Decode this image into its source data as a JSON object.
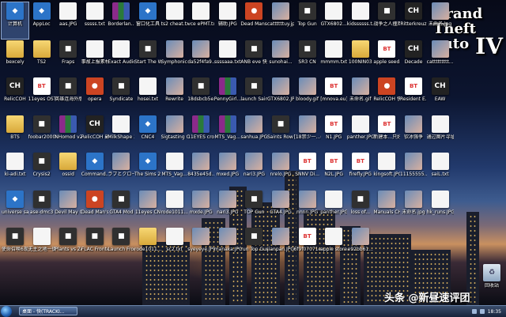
{
  "desktop": {
    "watermark": {
      "line1": "Grand",
      "line2": "Theft",
      "line3": "auto",
      "roman": "IV"
    }
  },
  "icons": [
    {
      "label": "计算机",
      "type": "blue",
      "sel": true
    },
    {
      "label": "AppLoc",
      "type": "blue"
    },
    {
      "label": "aas.JPG",
      "type": "doc"
    },
    {
      "label": "sssss.txt",
      "type": "doc"
    },
    {
      "label": "Borderlan...",
      "type": "rar"
    },
    {
      "label": "窗口化工具",
      "type": "blue"
    },
    {
      "label": "ts2 cheat.txt",
      "type": "doc"
    },
    {
      "label": "vce ePMT.txt",
      "type": "doc"
    },
    {
      "label": "辅助.JPG",
      "type": "doc"
    },
    {
      "label": "Dead Mans Hand",
      "type": "red"
    },
    {
      "label": "cattttttuy.jpg",
      "type": "img"
    },
    {
      "label": "Top Gun",
      "type": "dark"
    },
    {
      "label": "GTX6802...",
      "type": "doc"
    },
    {
      "label": "kidssssss.t...",
      "type": "doc"
    },
    {
      "label": "战争之人撞库中文版",
      "type": "dark"
    },
    {
      "label": "Ritterkreuz",
      "type": "ch"
    },
    {
      "label": "未命名.jpg",
      "type": "img"
    },
    {
      "label": "bexcely",
      "type": "folder"
    },
    {
      "label": "TS2",
      "type": "folder"
    },
    {
      "label": "Fraps",
      "type": "dark"
    },
    {
      "label": "事故上报素材.txt",
      "type": "doc"
    },
    {
      "label": "Exact Audio Copy",
      "type": "doc"
    },
    {
      "label": "Start The Witcher 2",
      "type": "dark"
    },
    {
      "label": "Symphonic Rain",
      "type": "img"
    },
    {
      "label": "da52f4fa9...",
      "type": "img"
    },
    {
      "label": "ssssaaa.txt",
      "type": "doc"
    },
    {
      "label": "ANB eve 快捷方式",
      "type": "dark"
    },
    {
      "label": "sunohai...",
      "type": "img"
    },
    {
      "label": "SR3 CN",
      "type": "dark"
    },
    {
      "label": "mmmm.txt",
      "type": "doc"
    },
    {
      "label": "100NIN03",
      "type": "folder"
    },
    {
      "label": "apple seed.torrent",
      "type": "gif"
    },
    {
      "label": "Decade",
      "type": "ch"
    },
    {
      "label": "cattttttttt...",
      "type": "img"
    },
    {
      "label": "RelicCOH",
      "type": "ch"
    },
    {
      "label": "11eyes OST.torrent",
      "type": "gif"
    },
    {
      "label": "英雄连海外版",
      "type": "dark"
    },
    {
      "label": "opera",
      "type": "red"
    },
    {
      "label": "Syndicate",
      "type": "dark"
    },
    {
      "label": "hosei.txt",
      "type": "doc"
    },
    {
      "label": "Rewrite",
      "type": "img"
    },
    {
      "label": "18dsbcb5e...",
      "type": "dark"
    },
    {
      "label": "PennyGirl...",
      "type": "rar"
    },
    {
      "label": "launch Saints Ro...",
      "type": "dark"
    },
    {
      "label": "GTX6802.JPG",
      "type": "img"
    },
    {
      "label": "bloody.gif",
      "type": "img"
    },
    {
      "label": "[mnova.eu] 18x10040...",
      "type": "gif"
    },
    {
      "label": "未命名.gif",
      "type": "img"
    },
    {
      "label": "RelicCOH 快捷方式",
      "type": "red"
    },
    {
      "label": "Resident E...",
      "type": "gif"
    },
    {
      "label": "EAW",
      "type": "ch"
    },
    {
      "label": "BTS",
      "type": "folder"
    },
    {
      "label": "foobar2000",
      "type": "dark"
    },
    {
      "label": "NHomod v2.6026",
      "type": "rar"
    },
    {
      "label": "RelicCOH 副本",
      "type": "ch"
    },
    {
      "label": "MilkShape 3D 1.8.5",
      "type": "doc"
    },
    {
      "label": "CNC4",
      "type": "blue"
    },
    {
      "label": "Sigtasting CH5",
      "type": "img"
    },
    {
      "label": "11EYES crossover",
      "type": "rar"
    },
    {
      "label": "MTS_Vag...",
      "type": "rar"
    },
    {
      "label": "sanhua.JPG",
      "type": "img"
    },
    {
      "label": "Saints Row The Third",
      "type": "dark"
    },
    {
      "label": "[18禁少一...(10040)]...",
      "type": "img"
    },
    {
      "label": "N1.JPG",
      "type": "gif"
    },
    {
      "label": "panther.JPG",
      "type": "doc"
    },
    {
      "label": "新建本...只好一起...",
      "type": "gif"
    },
    {
      "label": "钦冰强争",
      "type": "img"
    },
    {
      "label": "通过图片寻址.docx",
      "type": "doc"
    },
    {
      "label": "ki-adi.txt",
      "type": "doc"
    },
    {
      "label": "Crysis2",
      "type": "dark"
    },
    {
      "label": "ossid",
      "type": "folder"
    },
    {
      "label": "Command...",
      "type": "blue"
    },
    {
      "label": "ラブとクローン スタイア",
      "type": "img"
    },
    {
      "label": "The Sims 2 Mansion...",
      "type": "blue"
    },
    {
      "label": "MTS_Vag...",
      "type": "doc"
    },
    {
      "label": "8435e45d...",
      "type": "img"
    },
    {
      "label": "mxed.JPG",
      "type": "img"
    },
    {
      "label": "nari3.JPG",
      "type": "img"
    },
    {
      "label": "nrelo.JPG",
      "type": "img"
    },
    {
      "label": "SNNV Di...",
      "type": "gif"
    },
    {
      "label": "N2L.JPG",
      "type": "gif"
    },
    {
      "label": "firefly.JPG",
      "type": "gif"
    },
    {
      "label": "kingsoft.JPG",
      "type": "doc"
    },
    {
      "label": "11155555...",
      "type": "img"
    },
    {
      "label": "saiL.txt",
      "type": "doc"
    },
    {
      "label": "universe sandbox",
      "type": "blue"
    },
    {
      "label": "ase-dmc3",
      "type": "dark"
    },
    {
      "label": "Devil May Cry 4",
      "type": "img"
    },
    {
      "label": "Dead Man's Hand",
      "type": "red"
    },
    {
      "label": "GTA4 Mod",
      "type": "dark"
    },
    {
      "label": "11eyes CN",
      "type": "img"
    },
    {
      "label": "rode1011...",
      "type": "doc"
    },
    {
      "label": "mxde.JPG",
      "type": "img"
    },
    {
      "label": "nari3.JPG",
      "type": "img"
    },
    {
      "label": "TOP Gun",
      "type": "dark"
    },
    {
      "label": "GTA4.JPG",
      "type": "img"
    },
    {
      "label": "nnnn.JPG",
      "type": "img"
    },
    {
      "label": "panther.JPG",
      "type": "doc"
    },
    {
      "label": "loss of...",
      "type": "dark"
    },
    {
      "label": "Manuals CHS",
      "type": "img"
    },
    {
      "label": "未命名.jpg",
      "type": "img"
    },
    {
      "label": "hk_runs.JPG",
      "type": "doc"
    },
    {
      "label": "使命召唤6现代战争3(新)",
      "type": "dark"
    },
    {
      "label": "无主之地一键补丁",
      "type": "doc"
    },
    {
      "label": "Plants vs Zombie...",
      "type": "dark"
    },
    {
      "label": "FLAC Frontend",
      "type": "dark"
    },
    {
      "label": "Launch Front L...",
      "type": "dark"
    },
    {
      "label": "rode1011...",
      "type": "folder"
    },
    {
      "label": "sc2.txt",
      "type": "doc"
    },
    {
      "label": "syeyeye.JPG",
      "type": "img"
    },
    {
      "label": "manaka.JPG",
      "type": "img"
    },
    {
      "label": "run Top Gun",
      "type": "dark"
    },
    {
      "label": "jianpan.JPG",
      "type": "img"
    },
    {
      "label": "6f9f07071e...",
      "type": "gif"
    },
    {
      "label": "apple store.JPG",
      "type": "doc"
    },
    {
      "label": "e92bb61...",
      "type": "img"
    }
  ],
  "recycle_bin": {
    "label": "回收站"
  },
  "taskbar": {
    "task_label": "桌面 - 快(TRACKI...",
    "clock": "18:35"
  },
  "watermark_caption": {
    "text": "头条 @新昼速评团"
  }
}
